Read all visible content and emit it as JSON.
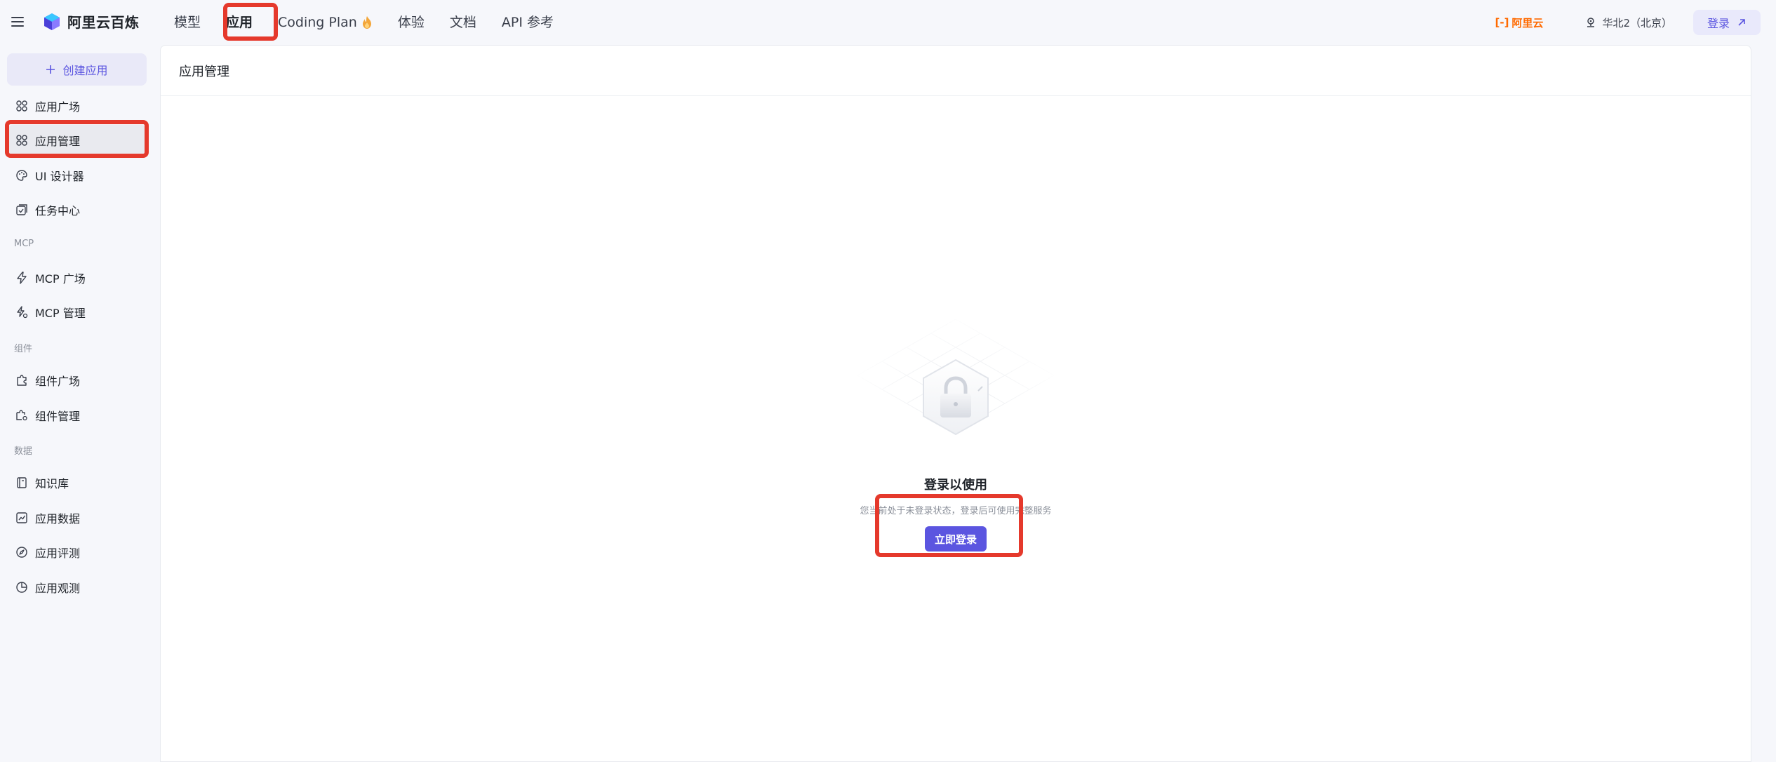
{
  "brand": {
    "name": "阿里云百炼"
  },
  "nav": {
    "items": [
      "模型",
      "应用",
      "Coding Plan",
      "体验",
      "文档",
      "API 参考"
    ]
  },
  "header_right": {
    "aliyun": "阿里云",
    "region": "华北2（北京）",
    "login": "登录"
  },
  "sidebar": {
    "create": "创建应用",
    "items": {
      "app_plaza": "应用广场",
      "app_manage": "应用管理",
      "ui_designer": "UI 设计器",
      "task_center": "任务中心",
      "mcp_plaza": "MCP 广场",
      "mcp_manage": "MCP 管理",
      "comp_plaza": "组件广场",
      "comp_manage": "组件管理",
      "kb": "知识库",
      "app_data": "应用数据",
      "app_eval": "应用评测",
      "app_observe": "应用观测"
    },
    "groups": {
      "mcp": "MCP",
      "components": "组件",
      "data": "数据"
    }
  },
  "main": {
    "title": "应用管理",
    "empty": {
      "title": "登录以使用",
      "desc": "您当前处于未登录状态，登录后可使用完整服务",
      "button": "立即登录"
    }
  },
  "colors": {
    "accent": "#5b55e0",
    "highlight": "#e5392c",
    "aliyun": "#ff6a00"
  }
}
